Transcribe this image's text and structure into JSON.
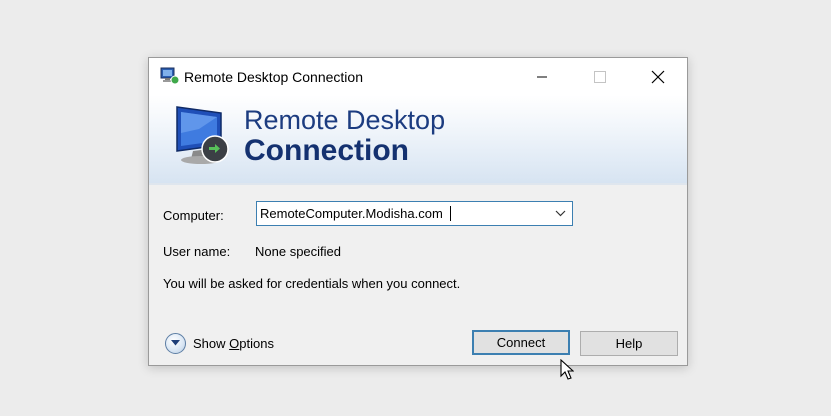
{
  "window": {
    "title": "Remote Desktop Connection",
    "icon": "remote-desktop-icon",
    "controls": {
      "minimize": "minimize-icon",
      "maximize": "maximize-icon",
      "close": "close-icon"
    }
  },
  "banner": {
    "line1": "Remote Desktop",
    "line2": "Connection",
    "icon": "remote-desktop-monitor-icon"
  },
  "form": {
    "computer_label": "Computer:",
    "computer_value": "RemoteComputer.Modisha.com",
    "username_label": "User name:",
    "username_value": "None specified",
    "credentials_note": "You will be asked for credentials when you connect."
  },
  "footer": {
    "show_options_prefix": "Show ",
    "show_options_accel": "O",
    "show_options_suffix": "ptions",
    "connect_label": "Connect",
    "help_label": "Help"
  },
  "colors": {
    "accent_border": "#3c7fb1",
    "banner_text": "#1c3c80",
    "page_background": "#ececec"
  }
}
